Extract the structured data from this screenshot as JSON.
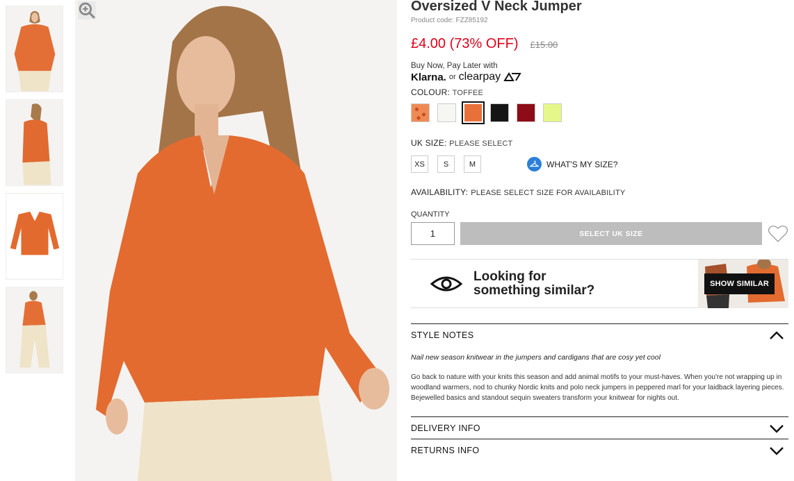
{
  "product": {
    "title": "Oversized V Neck Jumper",
    "code": "Product code: FZZ85192",
    "price_now": "£4.00 (73% OFF)",
    "price_was": "£15.00",
    "accent_color": "#e1001a"
  },
  "bnpl": {
    "text": "Buy Now, Pay Later with",
    "klarna": "Klarna.",
    "or": "or",
    "clearpay": "clearpay"
  },
  "colour": {
    "label": "COLOUR:",
    "value": "TOFFEE",
    "swatches": [
      {
        "name": "leopard",
        "color": "#f08a55"
      },
      {
        "name": "white",
        "color": "#f6f6f3"
      },
      {
        "name": "toffee",
        "color": "#e8713a"
      },
      {
        "name": "black",
        "color": "#151515"
      },
      {
        "name": "wine",
        "color": "#8e0c17"
      },
      {
        "name": "lime",
        "color": "#e6f78a"
      }
    ]
  },
  "size": {
    "label": "UK SIZE:",
    "value": "PLEASE SELECT",
    "options": [
      "XS",
      "S",
      "M"
    ],
    "whats_my_size": "WHAT'S MY SIZE?"
  },
  "availability": {
    "label": "AVAILABILITY:",
    "value": "PLEASE SELECT SIZE FOR AVAILABILITY"
  },
  "quantity": {
    "label": "QUANTITY",
    "value": "1"
  },
  "add_button": "SELECT UK SIZE",
  "similar": {
    "line1": "Looking for",
    "line2": "something similar?",
    "button": "SHOW SIMILAR"
  },
  "style_notes": {
    "heading": "STYLE NOTES",
    "intro": "Nail new season knitwear in the jumpers and cardigans that are cosy yet cool",
    "body": "Go back to nature with your knits this season and add animal motifs to your must-haves. When you're not wrapping up in woodland warmers, nod to chunky Nordic knits and polo neck jumpers in peppered marl for your laidback layering pieces. Bejewelled basics and standout sequin sweaters transform your knitwear for nights out."
  },
  "delivery": {
    "heading": "DELIVERY INFO"
  },
  "returns": {
    "heading": "RETURNS INFO"
  },
  "icons": {
    "zoom": "zoom-icon",
    "hanger": "hanger-icon",
    "wishlist": "heart-icon",
    "eye": "eye-icon",
    "chevron_up": "chevron-up-icon",
    "chevron_down": "chevron-down-icon"
  }
}
